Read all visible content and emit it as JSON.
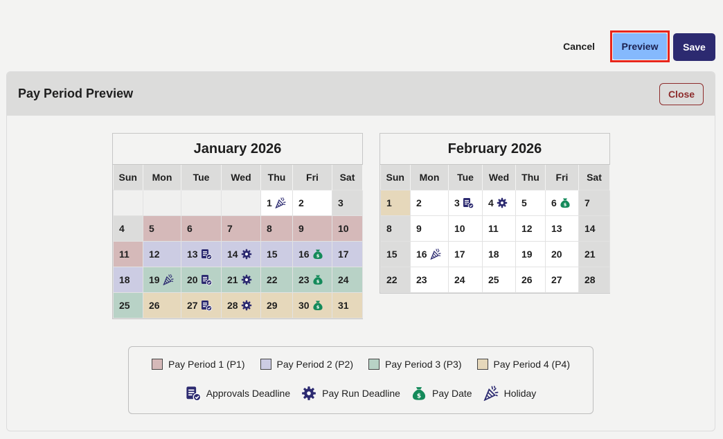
{
  "toolbar": {
    "cancel_label": "Cancel",
    "preview_label": "Preview",
    "save_label": "Save"
  },
  "panel": {
    "title": "Pay Period Preview",
    "close_label": "Close"
  },
  "colors": {
    "p1": "#d5b9b9",
    "p2": "#cccce3",
    "p3": "#b8d2c6",
    "p4": "#e6d8bb",
    "icon_navy": "#2c2a70",
    "icon_green": "#148a5a"
  },
  "weekdays": [
    "Sun",
    "Mon",
    "Tue",
    "Wed",
    "Thu",
    "Fri",
    "Sat"
  ],
  "calendars": [
    {
      "title": "January 2026",
      "weeks": [
        [
          {
            "d": "",
            "c": "empty"
          },
          {
            "d": "",
            "c": "empty"
          },
          {
            "d": "",
            "c": "empty"
          },
          {
            "d": "",
            "c": "empty"
          },
          {
            "d": "1",
            "c": "",
            "i": "holiday"
          },
          {
            "d": "2",
            "c": ""
          },
          {
            "d": "3",
            "c": "wk"
          }
        ],
        [
          {
            "d": "4",
            "c": "wk"
          },
          {
            "d": "5",
            "c": "p1"
          },
          {
            "d": "6",
            "c": "p1"
          },
          {
            "d": "7",
            "c": "p1"
          },
          {
            "d": "8",
            "c": "p1"
          },
          {
            "d": "9",
            "c": "p1"
          },
          {
            "d": "10",
            "c": "p1"
          }
        ],
        [
          {
            "d": "11",
            "c": "p1"
          },
          {
            "d": "12",
            "c": "p2"
          },
          {
            "d": "13",
            "c": "p2",
            "i": "approvals"
          },
          {
            "d": "14",
            "c": "p2",
            "i": "payrun"
          },
          {
            "d": "15",
            "c": "p2"
          },
          {
            "d": "16",
            "c": "p2",
            "i": "paydate"
          },
          {
            "d": "17",
            "c": "p2"
          }
        ],
        [
          {
            "d": "18",
            "c": "p2"
          },
          {
            "d": "19",
            "c": "p3",
            "i": "holiday"
          },
          {
            "d": "20",
            "c": "p3",
            "i": "approvals"
          },
          {
            "d": "21",
            "c": "p3",
            "i": "payrun"
          },
          {
            "d": "22",
            "c": "p3"
          },
          {
            "d": "23",
            "c": "p3",
            "i": "paydate"
          },
          {
            "d": "24",
            "c": "p3"
          }
        ],
        [
          {
            "d": "25",
            "c": "p3"
          },
          {
            "d": "26",
            "c": "p4"
          },
          {
            "d": "27",
            "c": "p4",
            "i": "approvals"
          },
          {
            "d": "28",
            "c": "p4",
            "i": "payrun"
          },
          {
            "d": "29",
            "c": "p4"
          },
          {
            "d": "30",
            "c": "p4",
            "i": "paydate"
          },
          {
            "d": "31",
            "c": "p4"
          }
        ]
      ]
    },
    {
      "title": "February 2026",
      "weeks": [
        [
          {
            "d": "1",
            "c": "p4"
          },
          {
            "d": "2",
            "c": ""
          },
          {
            "d": "3",
            "c": "",
            "i": "approvals"
          },
          {
            "d": "4",
            "c": "",
            "i": "payrun"
          },
          {
            "d": "5",
            "c": ""
          },
          {
            "d": "6",
            "c": "",
            "i": "paydate"
          },
          {
            "d": "7",
            "c": "wk"
          }
        ],
        [
          {
            "d": "8",
            "c": "wk"
          },
          {
            "d": "9",
            "c": ""
          },
          {
            "d": "10",
            "c": ""
          },
          {
            "d": "11",
            "c": ""
          },
          {
            "d": "12",
            "c": ""
          },
          {
            "d": "13",
            "c": ""
          },
          {
            "d": "14",
            "c": "wk"
          }
        ],
        [
          {
            "d": "15",
            "c": "wk"
          },
          {
            "d": "16",
            "c": "",
            "i": "holiday"
          },
          {
            "d": "17",
            "c": ""
          },
          {
            "d": "18",
            "c": ""
          },
          {
            "d": "19",
            "c": ""
          },
          {
            "d": "20",
            "c": ""
          },
          {
            "d": "21",
            "c": "wk"
          }
        ],
        [
          {
            "d": "22",
            "c": "wk"
          },
          {
            "d": "23",
            "c": ""
          },
          {
            "d": "24",
            "c": ""
          },
          {
            "d": "25",
            "c": ""
          },
          {
            "d": "26",
            "c": ""
          },
          {
            "d": "27",
            "c": ""
          },
          {
            "d": "28",
            "c": "wk"
          }
        ]
      ]
    }
  ],
  "legend": {
    "periods": [
      {
        "label": "Pay Period 1 (P1)",
        "color": "#d5b9b9"
      },
      {
        "label": "Pay Period 2 (P2)",
        "color": "#cccce3"
      },
      {
        "label": "Pay Period 3 (P3)",
        "color": "#b8d2c6"
      },
      {
        "label": "Pay Period 4 (P4)",
        "color": "#e6d8bb"
      }
    ],
    "markers": [
      {
        "label": "Approvals Deadline",
        "icon": "approvals-icon"
      },
      {
        "label": "Pay Run Deadline",
        "icon": "payrun-icon"
      },
      {
        "label": "Pay Date",
        "icon": "paydate-icon"
      },
      {
        "label": "Holiday",
        "icon": "holiday-icon"
      }
    ]
  }
}
